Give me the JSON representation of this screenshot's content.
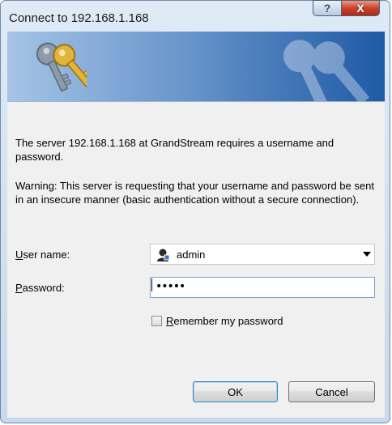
{
  "window": {
    "title": "Connect to 192.168.1.168",
    "help_label": "?",
    "close_label": "X"
  },
  "dialog": {
    "message": "The server 192.168.1.168 at GrandStream requires a username and password.",
    "warning": "Warning: This server is requesting that your username and password be sent in an insecure manner (basic authentication without a secure connection).",
    "username_label": "User name:",
    "username_value": "admin",
    "password_label": "Password:",
    "password_value": "•••••",
    "remember_label": "Remember my password",
    "remember_checked": false,
    "ok_label": "OK",
    "cancel_label": "Cancel"
  },
  "colors": {
    "banner_start": "#a5c4e6",
    "banner_end": "#1f5aa6",
    "key_gold": "#e2b53a",
    "key_gray": "#8d9aa8"
  }
}
